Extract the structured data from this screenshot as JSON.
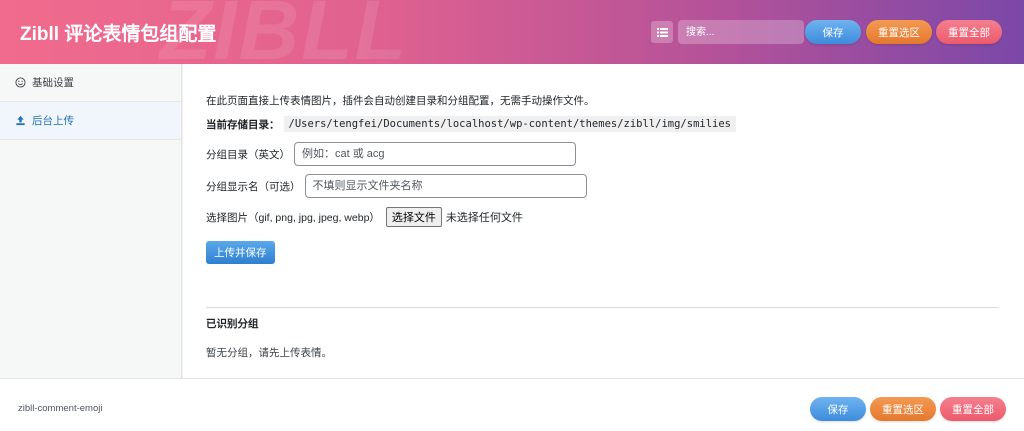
{
  "header": {
    "title": "Zibll 评论表情包组配置",
    "watermark": "ZIBLL",
    "search_placeholder": "搜索...",
    "list_icon": "list-icon",
    "buttons": {
      "save": "保存",
      "reset_section": "重置选区",
      "reset_all": "重置全部"
    }
  },
  "sidebar": {
    "items": [
      {
        "label": "基础设置",
        "icon": "smiley-icon",
        "active": false
      },
      {
        "label": "后台上传",
        "icon": "upload-icon",
        "active": true
      }
    ]
  },
  "main": {
    "intro": "在此页面直接上传表情图片，插件会自动创建目录和分组配置，无需手动操作文件。",
    "path_label": "当前存储目录：",
    "path_value": "/Users/tengfei/Documents/localhost/wp-content/themes/zibll/img/smilies",
    "group_dir": {
      "label": "分组目录（英文）",
      "placeholder": "例如：cat 或 acg",
      "value": ""
    },
    "group_name": {
      "label": "分组显示名（可选）",
      "placeholder": "不填则显示文件夹名称",
      "value": ""
    },
    "file": {
      "label": "选择图片（gif, png, jpg, jpeg, webp）",
      "button": "选择文件",
      "status": "未选择任何文件"
    },
    "upload_button": "上传并保存",
    "recognized_title": "已识别分组",
    "empty_note": "暂无分组，请先上传表情。"
  },
  "footer": {
    "slug": "zibll-comment-emoji",
    "buttons": {
      "save": "保存",
      "reset_section": "重置选区",
      "reset_all": "重置全部"
    }
  },
  "colors": {
    "header_gradient_start": "#f16b8d",
    "header_gradient_end": "#7b48a8",
    "save": "#3d8bdc",
    "reset_section": "#e5782e",
    "reset_all": "#ec5a6c",
    "active_nav": "#2271b1"
  }
}
